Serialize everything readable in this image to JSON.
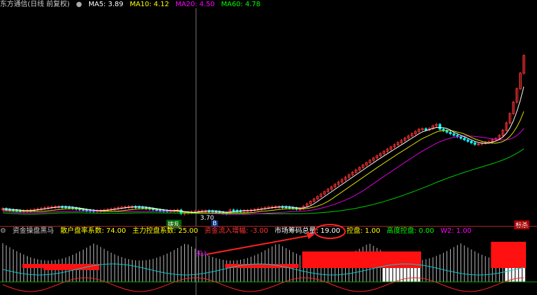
{
  "main": {
    "title": "东方通信(日线 前复权)",
    "ma": [
      {
        "label": "MA5: 3.89",
        "color": "#ffffff"
      },
      {
        "label": "MA10: 4.12",
        "color": "#ffff00"
      },
      {
        "label": "MA20: 4.50",
        "color": "#ff00ff"
      },
      {
        "label": "MA60: 4.78",
        "color": "#00ff00"
      }
    ],
    "low_label": "3.70",
    "b_label": "B",
    "sell_tag": "标杀",
    "buy_tag": "拨乱"
  },
  "indicator": {
    "name": "资金操盘黑马",
    "params": [
      {
        "label": "散户盘率系数: 74.00",
        "color": "#ffff00"
      },
      {
        "label": "主力控盘系数: 25.00",
        "color": "#ffff00"
      },
      {
        "label": "资金流入增幅: -3.00",
        "color": "#ff3333"
      },
      {
        "label": "市场筹码总量: 19.00",
        "color": "#ffffff"
      },
      {
        "label": "控盘: 1.00",
        "color": "#ffff00"
      },
      {
        "label": "高度控盘: 0.00",
        "color": "#00ff00"
      },
      {
        "label": "W2: 1.00",
        "color": "#ff00ff"
      }
    ],
    "marker": "买入"
  },
  "colors": {
    "up": "#ff3333",
    "down": "#00ffff",
    "separator": "#aa2222"
  }
}
